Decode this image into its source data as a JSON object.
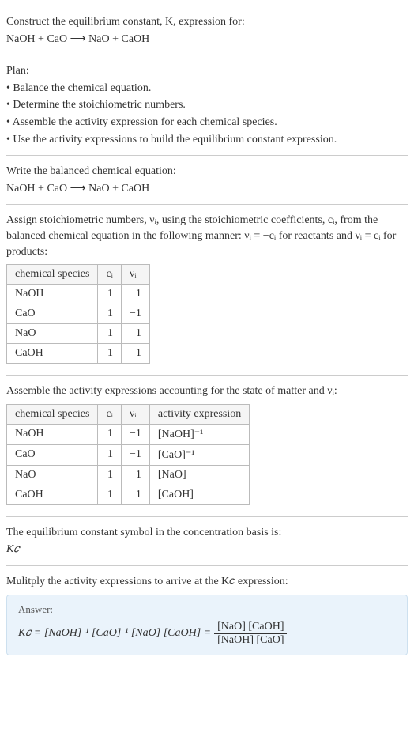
{
  "section1": {
    "l1": "Construct the equilibrium constant, K, expression for:",
    "l2": "NaOH + CaO ⟶ NaO + CaOH"
  },
  "section2": {
    "l1": "Plan:",
    "l2": "• Balance the chemical equation.",
    "l3": "• Determine the stoichiometric numbers.",
    "l4": "• Assemble the activity expression for each chemical species.",
    "l5": "• Use the activity expressions to build the equilibrium constant expression."
  },
  "section3": {
    "l1": "Write the balanced chemical equation:",
    "l2": "NaOH + CaO ⟶ NaO + CaOH"
  },
  "section4": {
    "intro1": "Assign stoichiometric numbers, νᵢ, using the stoichiometric coefficients, cᵢ, from the balanced chemical equation in the following manner: νᵢ = −cᵢ for reactants and νᵢ = cᵢ for products:",
    "headers": {
      "h1": "chemical species",
      "h2": "cᵢ",
      "h3": "νᵢ"
    },
    "rows": [
      {
        "sp": "NaOH",
        "c": "1",
        "v": "−1"
      },
      {
        "sp": "CaO",
        "c": "1",
        "v": "−1"
      },
      {
        "sp": "NaO",
        "c": "1",
        "v": "1"
      },
      {
        "sp": "CaOH",
        "c": "1",
        "v": "1"
      }
    ]
  },
  "section5": {
    "intro": "Assemble the activity expressions accounting for the state of matter and νᵢ:",
    "headers": {
      "h1": "chemical species",
      "h2": "cᵢ",
      "h3": "νᵢ",
      "h4": "activity expression"
    },
    "rows": [
      {
        "sp": "NaOH",
        "c": "1",
        "v": "−1",
        "a": "[NaOH]⁻¹"
      },
      {
        "sp": "CaO",
        "c": "1",
        "v": "−1",
        "a": "[CaO]⁻¹"
      },
      {
        "sp": "NaO",
        "c": "1",
        "v": "1",
        "a": "[NaO]"
      },
      {
        "sp": "CaOH",
        "c": "1",
        "v": "1",
        "a": "[CaOH]"
      }
    ]
  },
  "section6": {
    "l1": "The equilibrium constant symbol in the concentration basis is:",
    "l2": "K𝑐"
  },
  "section7": {
    "l1": "Mulitply the activity expressions to arrive at the K𝑐 expression:",
    "answerLabel": "Answer:",
    "lhs": "K𝑐 = [NaOH]⁻¹ [CaO]⁻¹ [NaO] [CaOH] = ",
    "fracNum": "[NaO] [CaOH]",
    "fracDen": "[NaOH] [CaO]"
  },
  "chart_data": {
    "type": "table",
    "tables": [
      {
        "title": "Stoichiometric numbers",
        "columns": [
          "chemical species",
          "c_i",
          "ν_i"
        ],
        "rows": [
          [
            "NaOH",
            1,
            -1
          ],
          [
            "CaO",
            1,
            -1
          ],
          [
            "NaO",
            1,
            1
          ],
          [
            "CaOH",
            1,
            1
          ]
        ]
      },
      {
        "title": "Activity expressions",
        "columns": [
          "chemical species",
          "c_i",
          "ν_i",
          "activity expression"
        ],
        "rows": [
          [
            "NaOH",
            1,
            -1,
            "[NaOH]^-1"
          ],
          [
            "CaO",
            1,
            -1,
            "[CaO]^-1"
          ],
          [
            "NaO",
            1,
            1,
            "[NaO]"
          ],
          [
            "CaOH",
            1,
            1,
            "[CaOH]"
          ]
        ]
      }
    ]
  }
}
